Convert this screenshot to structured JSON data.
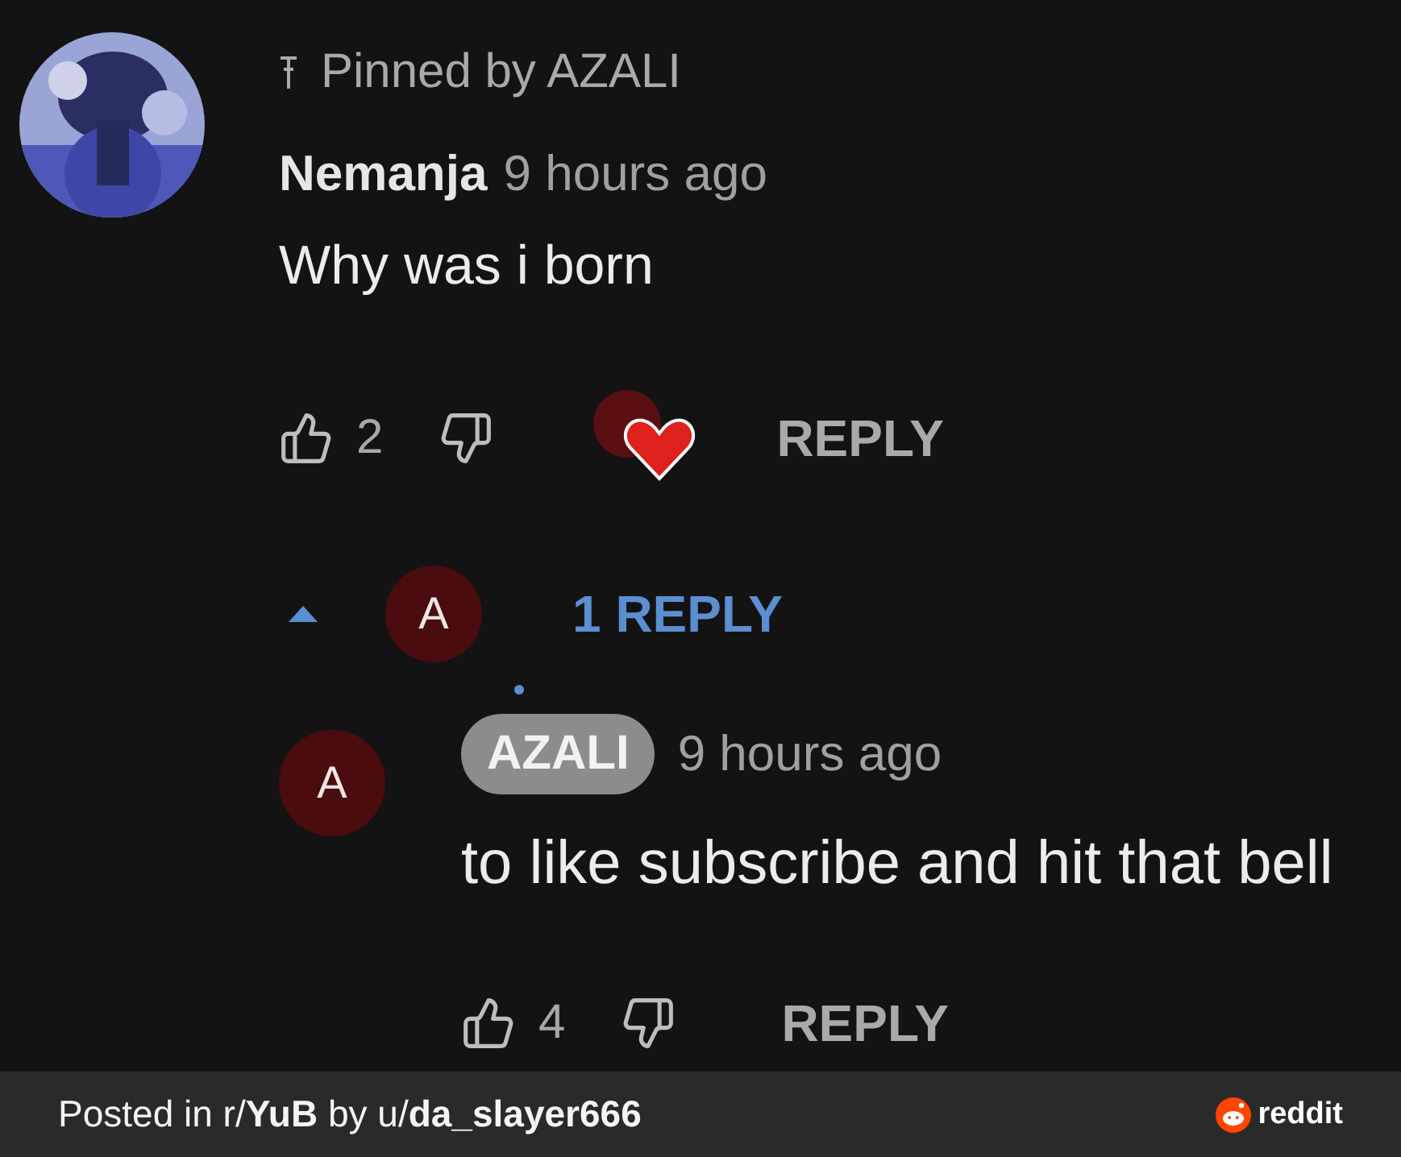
{
  "comment": {
    "pinned_by": "Pinned by AZALI",
    "author": "Nemanja",
    "time": "9 hours ago",
    "text": "Why was i born",
    "likes": "2",
    "hearted": true,
    "reply_label": "REPLY",
    "replies_toggle": {
      "expanded": true,
      "avatar_letter": "A",
      "label": "1 REPLY"
    }
  },
  "replies": [
    {
      "avatar_letter": "A",
      "author": "AZALI",
      "is_creator": true,
      "time": "9 hours ago",
      "text": "to like subscribe and hit that bell",
      "likes": "4",
      "reply_label": "REPLY"
    }
  ],
  "footer": {
    "caption": "Posted in r/**YuB** by u/**da_slayer666**",
    "brand": "reddit"
  }
}
